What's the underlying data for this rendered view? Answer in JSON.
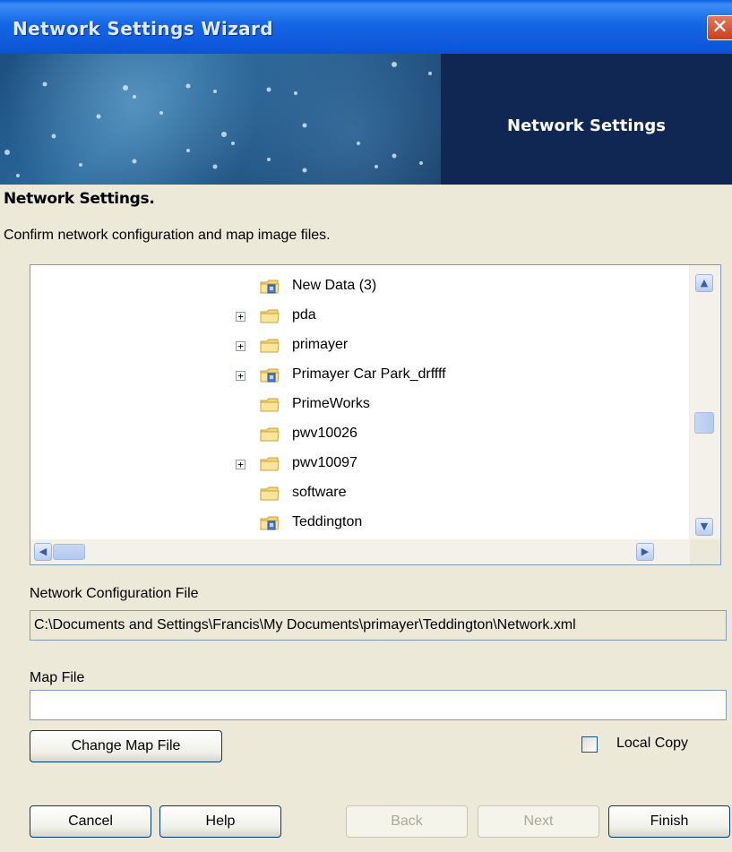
{
  "window": {
    "title": "Network Settings Wizard",
    "close_glyph": "✕"
  },
  "banner": {
    "title": "Network Settings"
  },
  "page": {
    "heading": "Network Settings.",
    "description": "Confirm network configuration and map image files."
  },
  "tree": {
    "items": [
      {
        "label": "New Data (3)",
        "icon": "shared-folder-icon",
        "expandable": false
      },
      {
        "label": "pda",
        "icon": "folder-icon",
        "expandable": true
      },
      {
        "label": "primayer",
        "icon": "folder-icon",
        "expandable": true
      },
      {
        "label": "Primayer Car Park_drffff",
        "icon": "shared-folder-icon",
        "expandable": true
      },
      {
        "label": "PrimeWorks",
        "icon": "folder-icon",
        "expandable": false
      },
      {
        "label": "pwv10026",
        "icon": "folder-icon",
        "expandable": false
      },
      {
        "label": "pwv10097",
        "icon": "folder-icon",
        "expandable": true
      },
      {
        "label": "software",
        "icon": "folder-icon",
        "expandable": false
      },
      {
        "label": "Teddington",
        "icon": "shared-folder-icon",
        "expandable": false
      }
    ],
    "expander_glyph": "+"
  },
  "network_config": {
    "label": "Network Configuration File",
    "value": "C:\\Documents and Settings\\Francis\\My Documents\\primayer\\Teddington\\Network.xml"
  },
  "map_file": {
    "label": "Map File",
    "value": ""
  },
  "buttons": {
    "change_map": "Change Map File",
    "local_copy": "Local Copy",
    "cancel": "Cancel",
    "help": "Help",
    "back": "Back",
    "next": "Next",
    "finish": "Finish"
  },
  "colors": {
    "titlebar": "#0b53d6",
    "banner_dark": "#0f2752",
    "dialog_bg": "#ece9d8",
    "folder": "#f5d77a"
  }
}
